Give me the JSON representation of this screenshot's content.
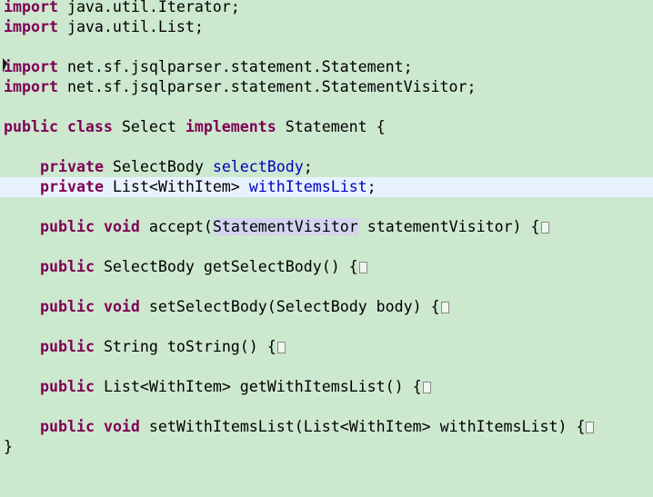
{
  "keywords": {
    "import": "import",
    "public": "public",
    "class": "class",
    "implements": "implements",
    "private": "private",
    "void": "void"
  },
  "imports": [
    "java.util.Iterator;",
    "java.util.List;",
    "net.sf.jsqlparser.statement.Statement;",
    "net.sf.jsqlparser.statement.StatementVisitor;"
  ],
  "class_decl": {
    "name": " Select ",
    "iface": " Statement {"
  },
  "fields": [
    {
      "type": " SelectBody ",
      "name": "selectBody",
      "end": ";"
    },
    {
      "type": " List<WithItem> ",
      "name": "withItemsList",
      "end": ";"
    }
  ],
  "methods": {
    "accept": {
      "pre": " accept(",
      "param_type": "StatementVisitor",
      "post": " statementVisitor) {"
    },
    "getSelectBody": " SelectBody getSelectBody() {",
    "setSelectBody": " setSelectBody(SelectBody body) {",
    "toString": " String toString() {",
    "getWithItemsList": " List<WithItem> getWithItemsList() {",
    "setWithItemsList": " setWithItemsList(List<WithItem> withItemsList) {"
  },
  "closing_brace": "}",
  "colors": {
    "background": "#cce8cf",
    "keyword": "#7f0055",
    "field": "#0000c0",
    "current_line": "#e8f2fe",
    "occurrence_highlight": "#d4d4f0"
  }
}
